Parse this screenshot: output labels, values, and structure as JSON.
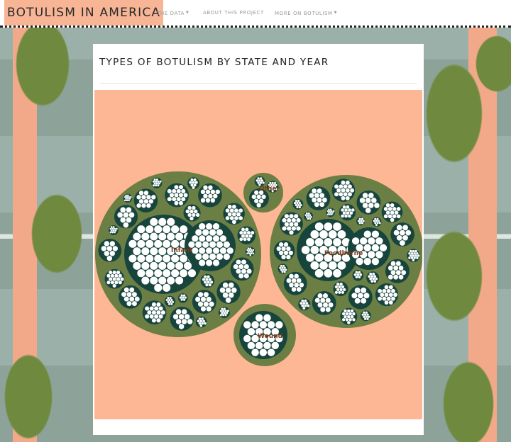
{
  "navbar": {
    "brand": "BOTULISM IN AMERICA",
    "items": [
      {
        "label": "THE DATA",
        "has_caret": true
      },
      {
        "label": "ABOUT THIS PROJECT",
        "has_caret": false
      },
      {
        "label": "MORE ON BOTULISM",
        "has_caret": true
      }
    ]
  },
  "panel": {
    "title": "TYPES OF BOTULISM BY STATE AND YEAR"
  },
  "pack": {
    "groups": [
      {
        "label": "Infant"
      },
      {
        "label": "Other"
      },
      {
        "label": "Foodborne"
      },
      {
        "label": "Wound"
      }
    ]
  },
  "colors": {
    "nav_brand_bg": "#f7b596",
    "viz_bg": "#fdb795",
    "outer_circle": "#6b7f44",
    "mid_circle": "#17453e",
    "leaf_circle": "#ffffff",
    "label_text": "#7a3a1a"
  }
}
